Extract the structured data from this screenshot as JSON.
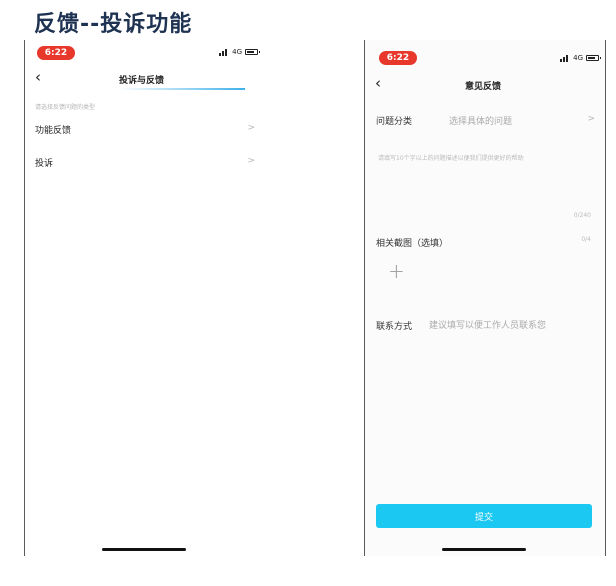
{
  "slide": {
    "title": "反馈--投诉功能"
  },
  "left_phone": {
    "status": {
      "time": "6:22",
      "network": "4G"
    },
    "nav": {
      "back_icon": "chevron-left-icon",
      "title": "投诉与反馈"
    },
    "hint": "请选择反馈问题的类型",
    "menu": [
      {
        "label": "功能反馈",
        "arrow": ">"
      },
      {
        "label": "投诉",
        "arrow": ">"
      }
    ]
  },
  "right_phone": {
    "status": {
      "time": "6:22",
      "network": "4G"
    },
    "nav": {
      "back_icon": "chevron-left-icon",
      "title": "意见反馈"
    },
    "category": {
      "label": "问题分类",
      "placeholder": "选择具体的问题",
      "arrow": ">"
    },
    "description": {
      "placeholder": "请填写10个字以上的问题描述以便我们提供更好的帮助",
      "counter": "0/240"
    },
    "screenshot": {
      "label": "相关截图（选填）",
      "counter": "0/4",
      "add_icon": "plus-icon"
    },
    "contact": {
      "label": "联系方式",
      "placeholder": "建议填写以便工作人员联系您"
    },
    "submit_label": "提交"
  },
  "colors": {
    "title": "#1e3252",
    "accent": "#1ac8f1",
    "status_badge": "#e8372b",
    "underline": "#3fb0ea"
  }
}
